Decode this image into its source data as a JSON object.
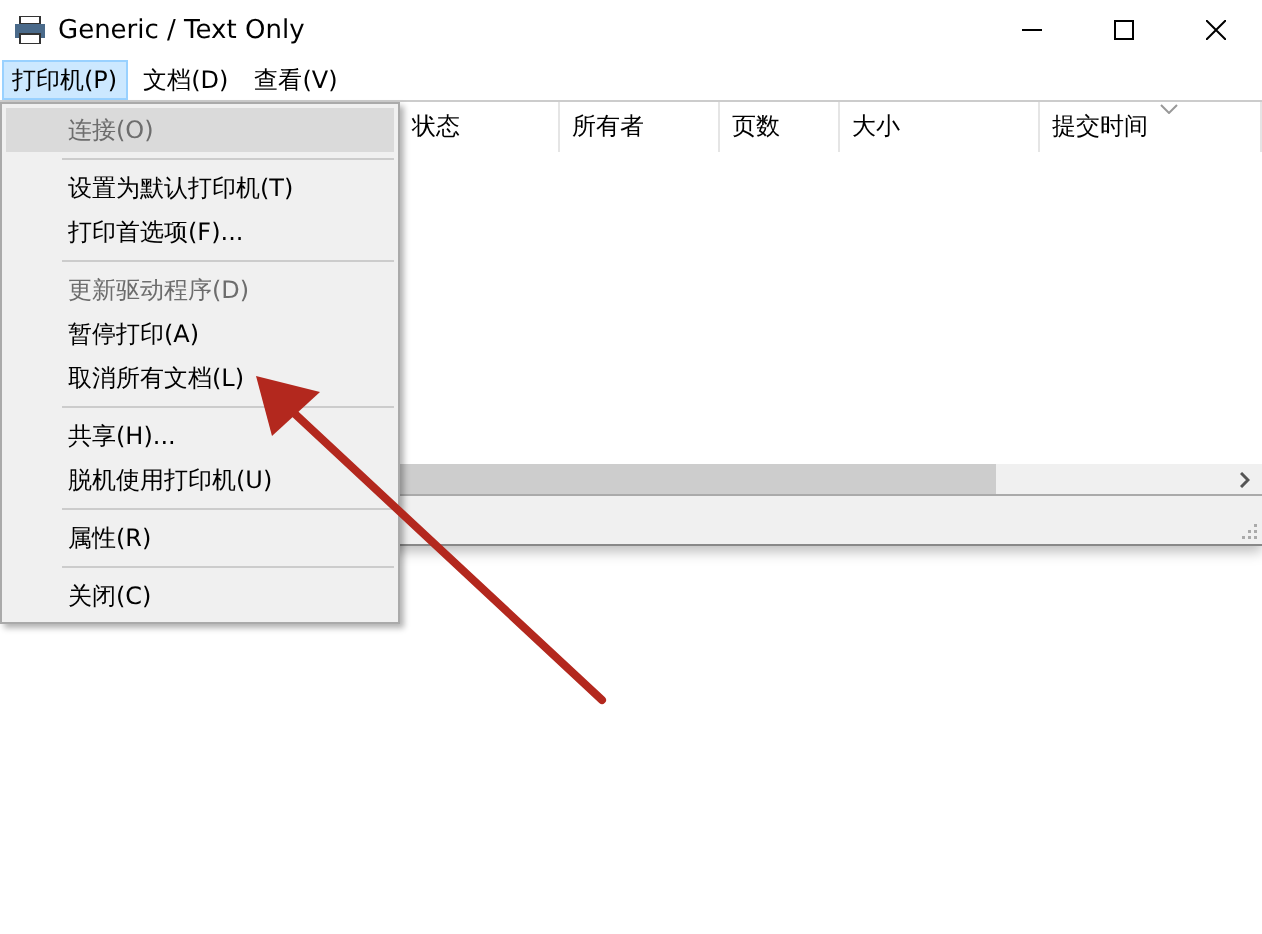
{
  "window": {
    "title": "Generic / Text Only"
  },
  "menu_bar": [
    {
      "label": "打印机(P)",
      "selected": true
    },
    {
      "label": "文档(D)",
      "selected": false
    },
    {
      "label": "查看(V)",
      "selected": false
    }
  ],
  "dropdown": [
    {
      "kind": "item",
      "label": "连接(O)",
      "disabled": true,
      "selected": true
    },
    {
      "kind": "separator"
    },
    {
      "kind": "item",
      "label": "设置为默认打印机(T)",
      "disabled": false,
      "selected": false
    },
    {
      "kind": "item",
      "label": "打印首选项(F)...",
      "disabled": false,
      "selected": false
    },
    {
      "kind": "separator"
    },
    {
      "kind": "item",
      "label": "更新驱动程序(D)",
      "disabled": true,
      "selected": false
    },
    {
      "kind": "item",
      "label": "暂停打印(A)",
      "disabled": false,
      "selected": false
    },
    {
      "kind": "item",
      "label": "取消所有文档(L)",
      "disabled": false,
      "selected": false
    },
    {
      "kind": "separator"
    },
    {
      "kind": "item",
      "label": "共享(H)...",
      "disabled": false,
      "selected": false
    },
    {
      "kind": "item",
      "label": "脱机使用打印机(U)",
      "disabled": false,
      "selected": false
    },
    {
      "kind": "separator"
    },
    {
      "kind": "item",
      "label": "属性(R)",
      "disabled": false,
      "selected": false
    },
    {
      "kind": "separator"
    },
    {
      "kind": "item",
      "label": "关闭(C)",
      "disabled": false,
      "selected": false
    }
  ],
  "table": {
    "columns": [
      "状态",
      "所有者",
      "页数",
      "大小",
      "提交时间"
    ]
  }
}
